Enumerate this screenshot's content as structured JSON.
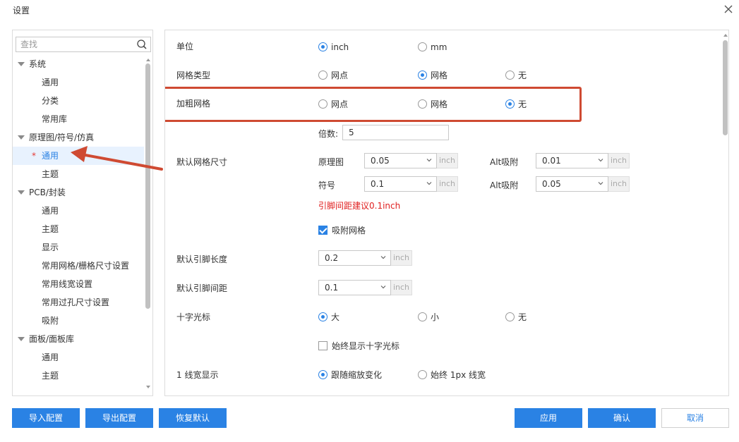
{
  "window": {
    "title": "设置"
  },
  "search": {
    "placeholder": "查找"
  },
  "tree": [
    {
      "label": "系统",
      "type": "category"
    },
    {
      "label": "通用",
      "type": "leaf"
    },
    {
      "label": "分类",
      "type": "leaf"
    },
    {
      "label": "常用库",
      "type": "leaf"
    },
    {
      "label": "原理图/符号/仿真",
      "type": "category"
    },
    {
      "label": "通用",
      "type": "leaf",
      "selected": true,
      "modified_mark": "*"
    },
    {
      "label": "主题",
      "type": "leaf"
    },
    {
      "label": "PCB/封装",
      "type": "category"
    },
    {
      "label": "通用",
      "type": "leaf"
    },
    {
      "label": "主题",
      "type": "leaf"
    },
    {
      "label": "显示",
      "type": "leaf"
    },
    {
      "label": "常用网格/栅格尺寸设置",
      "type": "leaf"
    },
    {
      "label": "常用线宽设置",
      "type": "leaf"
    },
    {
      "label": "常用过孔尺寸设置",
      "type": "leaf"
    },
    {
      "label": "吸附",
      "type": "leaf"
    },
    {
      "label": "面板/面板库",
      "type": "category"
    },
    {
      "label": "通用",
      "type": "leaf"
    },
    {
      "label": "主题",
      "type": "leaf"
    }
  ],
  "settings": {
    "unit": {
      "label": "单位",
      "options": [
        "inch",
        "mm"
      ],
      "selected": "inch"
    },
    "grid_type": {
      "label": "网格类型",
      "options": [
        "网点",
        "网格",
        "无"
      ],
      "selected": "网格"
    },
    "bold_grid": {
      "label": "加粗网格",
      "options": [
        "网点",
        "网格",
        "无"
      ],
      "selected": "无"
    },
    "multiple": {
      "label": "倍数:",
      "value": "5"
    },
    "default_grid_size": {
      "label": "默认网格尺寸",
      "schematic_label": "原理图",
      "schematic_value": "0.05",
      "symbol_label": "符号",
      "symbol_value": "0.1",
      "alt_label": "Alt吸附",
      "schematic_alt_value": "0.01",
      "symbol_alt_value": "0.05",
      "unit": "inch",
      "warning": "引脚间距建议0.1inch"
    },
    "snap_grid": {
      "label": "吸附网格",
      "checked": true
    },
    "default_pin_length": {
      "label": "默认引脚长度",
      "value": "0.2",
      "unit": "inch"
    },
    "default_pin_spacing": {
      "label": "默认引脚间距",
      "value": "0.1",
      "unit": "inch"
    },
    "crosshair": {
      "label": "十字光标",
      "options": [
        "大",
        "小",
        "无"
      ],
      "selected": "大"
    },
    "always_show_crosshair": {
      "label": "始终显示十字光标",
      "checked": false
    },
    "line_width_1": {
      "label": "1 线宽显示",
      "options": [
        "跟随缩放变化",
        "始终 1px 线宽"
      ],
      "selected": "跟随缩放变化"
    }
  },
  "buttons": {
    "import": "导入配置",
    "export": "导出配置",
    "reset": "恢复默认",
    "apply": "应用",
    "confirm": "确认",
    "cancel": "取消"
  },
  "colors": {
    "accent": "#2a82e4",
    "highlight": "#cf4a32",
    "warning": "#e02020"
  }
}
